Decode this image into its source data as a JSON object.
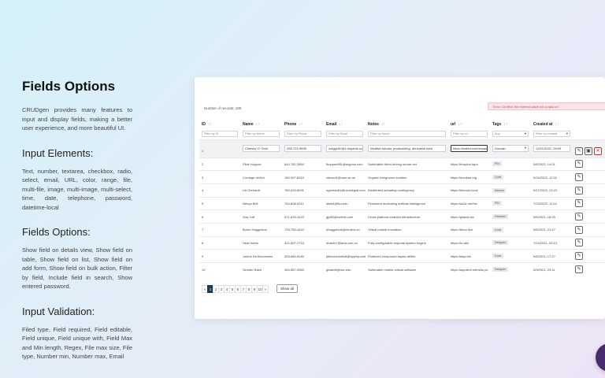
{
  "left": {
    "title": "Fields Options",
    "intro": "CRUDgen provides many features to input and display fields, making a better user experience, and more beautiful UI.",
    "sections": [
      {
        "heading": "Input Elements:",
        "text": "Text, number, textarea, checkbox, radio, select, email, URL, color, range, file, multi-file, image, multi-image, multi-select, time, date, telephone, password, datetime-local"
      },
      {
        "heading": "Fields Options:",
        "text": "Show field on details view, Show field on table, Show field on list, Show field on add form, Show field on bulk action, Filter by field, Include field in search, Show entered password."
      },
      {
        "heading": "Input Validation:",
        "text": "Filed type, Field required, Field editable, Field unique, Field unique with, Field Max and Min length, Regex, File max size, File type, Number min, Number max, Email"
      }
    ]
  },
  "table": {
    "record_count": "Number of records: 100",
    "alert": "Error: Url field, the entered value not a valid url",
    "columns": [
      {
        "label": "ID",
        "sort": "↓↑"
      },
      {
        "label": "Name",
        "sort": "↓↑"
      },
      {
        "label": "Phone",
        "sort": "↓↑"
      },
      {
        "label": "Email",
        "sort": "↓↑"
      },
      {
        "label": "Notes",
        "sort": "↓↑"
      },
      {
        "label": "url",
        "sort": "↓↑"
      },
      {
        "label": "Tags",
        "sort": "↓↑"
      },
      {
        "label": "Created at",
        "sort": "↓↑"
      },
      {
        "label": "",
        "sort": ""
      }
    ],
    "filters": [
      "Filter by ID",
      "Filter by Name",
      "Filter by Phone",
      "Filter by Email",
      "Filter by Notes",
      "Filter by url",
      "Any",
      "Filter by created"
    ],
    "edit_row": {
      "id": "1",
      "name": "Chelsey O' Grull",
      "phone": "256-722-9639",
      "email": "cofgg160@1-hispeds.co",
      "notes": "Intuitive tubular, productizing, derivative tube",
      "url": "https://tuslett.com/expand",
      "tag": "Domain",
      "created": "12/01/2021, 09:00"
    },
    "rows": [
      {
        "id": "2",
        "name": "Filde Hoppes",
        "phone": "644-781-2854",
        "email": "fhoppes981@mypost.com",
        "notes": "Switchable client-driving neural net",
        "url": "https://hospice.tapo",
        "tag": "PIN",
        "created": "5/6/2022, 14:01"
      },
      {
        "id": "3",
        "name": "Cordage deWol",
        "phone": "150-597-6019",
        "email": "cdewol1@cam.ac.uk",
        "notes": "Organic foreground solution",
        "url": "https://dumkao.org",
        "tag": "Code",
        "created": "5/16/2022, 12:02"
      },
      {
        "id": "4",
        "name": "Uri Gerhardt",
        "phone": "760-833-8091",
        "email": "ugerhardt1@ucvidegoli.com",
        "notes": "Distributed actuating contingency",
        "url": "https://lemodo.local",
        "tag": "Manual",
        "created": "6/17/2022, 13:23"
      },
      {
        "id": "5",
        "name": "Nenya Bell",
        "phone": "764-838-5311",
        "email": "sbell4@fsu.edu",
        "notes": "Persistent motivating artificial intelligence",
        "url": "https://ad2z.net/hw",
        "tag": "PIN",
        "created": "7/23/2022, 11:04"
      },
      {
        "id": "6",
        "name": "Gay Juff",
        "phone": "571-633-4423",
        "email": "gjuff5@surfbiz.com",
        "notes": "Cross-platform-enabled infrastructure",
        "url": "https://gilacia.bio",
        "tag": "Pasteboi",
        "created": "5/5/2021, 18:25"
      },
      {
        "id": "7",
        "name": "Burke Haggeston",
        "phone": "733-750-4442",
        "email": "bhaggston6@reuters.co",
        "notes": "Virtual mobile emulation",
        "url": "https://bima.fish",
        "tag": "Code",
        "created": "5/6/2021, 21:47"
      },
      {
        "id": "8",
        "name": "Heal Harris",
        "phone": "321-897-2715",
        "email": "hharris7@sina.com.cn",
        "notes": "Fully-configurable regional system engine",
        "url": "https://hr.wiki",
        "tag": "Designer",
        "created": "7/14/2021, 03:13"
      },
      {
        "id": "9",
        "name": "Jolene De Broomnels",
        "phone": "303-680-8184",
        "email": "jdebroomnels8@xippey.com",
        "notes": "Polarized compound bayes-define",
        "url": "https://aiqa.ink",
        "tag": "Code",
        "created": "5/8/2021, 17:27"
      },
      {
        "id": "10",
        "name": "Sirinder Bash",
        "phone": "454-567-9563",
        "email": "gbash9@cue.edu",
        "notes": "Switchable mobile-critical software",
        "url": "https://aspdevil.mensho.yo",
        "tag": "Designer",
        "created": "5/9/2021, 23:11"
      }
    ],
    "pages": [
      "«",
      "1",
      "2",
      "3",
      "4",
      "5",
      "6",
      "7",
      "8",
      "9",
      "10",
      "»"
    ],
    "active_page": "1",
    "show_all": "Show all"
  },
  "icons": {
    "edit": "edit-icon",
    "save": "save-icon",
    "delete": "trash-icon"
  },
  "colors": {
    "active_page": "#1a3a52",
    "alert_bg": "#fbe4e6",
    "fab": "#4a2b6e"
  }
}
